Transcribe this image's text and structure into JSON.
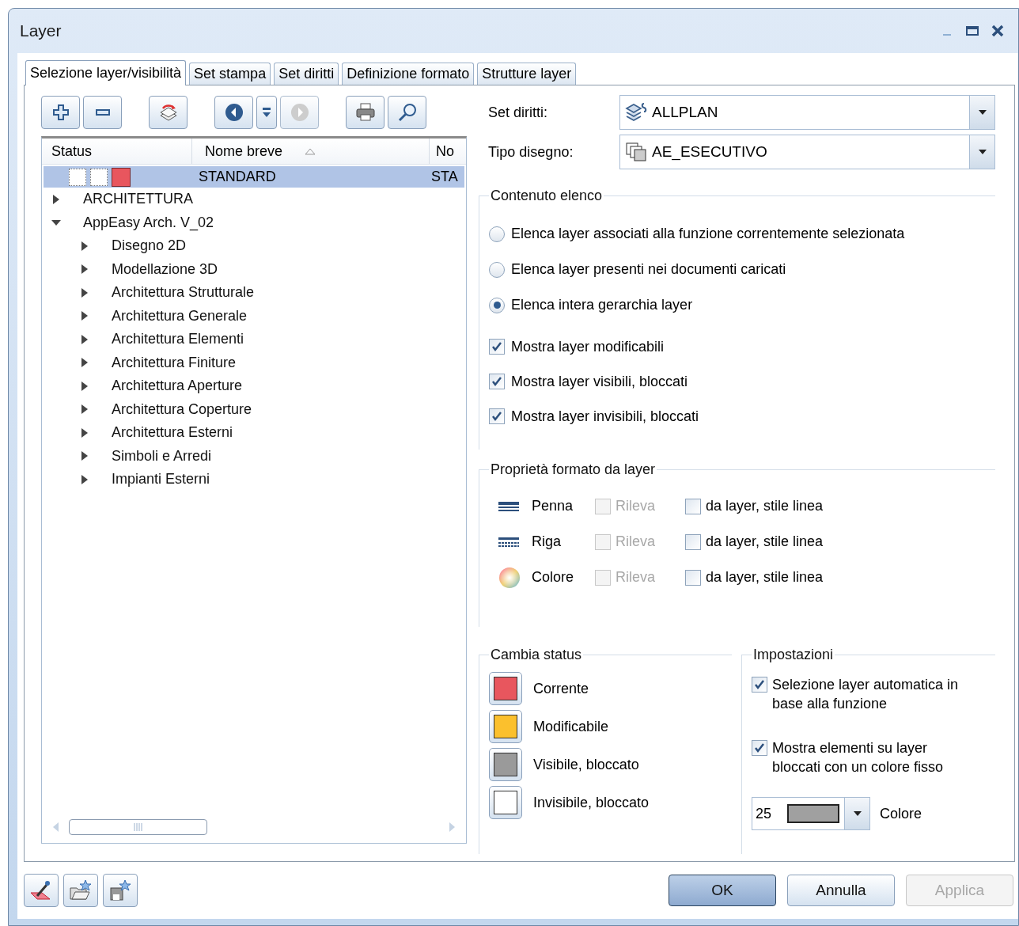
{
  "window": {
    "title": "Layer"
  },
  "tabs": [
    {
      "label": "Selezione layer/visibilità",
      "selected": true
    },
    {
      "label": "Set stampa",
      "selected": false
    },
    {
      "label": "Set diritti",
      "selected": false
    },
    {
      "label": "Definizione formato",
      "selected": false
    },
    {
      "label": "Strutture layer",
      "selected": false
    }
  ],
  "toolbar": [
    {
      "kind": "add",
      "disabled": false
    },
    {
      "kind": "remove",
      "disabled": false
    },
    {
      "kind": "refresh",
      "disabled": false
    },
    {
      "kind": "back",
      "disabled": false
    },
    {
      "kind": "menu",
      "disabled": false
    },
    {
      "kind": "forward",
      "disabled": true
    },
    {
      "kind": "print",
      "disabled": false
    },
    {
      "kind": "search",
      "disabled": false
    }
  ],
  "layer_list": {
    "columns": [
      {
        "label": "Status",
        "sorted": false
      },
      {
        "label": "Nome breve",
        "sorted": true
      },
      {
        "label": "No",
        "sorted": false
      }
    ],
    "current_row": {
      "short_name": "STANDARD",
      "column_3": "STA",
      "selected": true,
      "color": "#e8565e"
    },
    "tree": [
      {
        "label": "ARCHITETTURA",
        "expanded": false
      },
      {
        "label": "AppEasy Arch. V_02",
        "expanded": true,
        "children": [
          {
            "label": "Disegno 2D",
            "expanded": false
          },
          {
            "label": "Modellazione 3D",
            "expanded": false
          },
          {
            "label": "Architettura Strutturale",
            "expanded": false
          },
          {
            "label": "Architettura Generale",
            "expanded": false
          },
          {
            "label": "Architettura Elementi",
            "expanded": false
          },
          {
            "label": "Architettura Finiture",
            "expanded": false
          },
          {
            "label": "Architettura Aperture",
            "expanded": false
          },
          {
            "label": "Architettura Coperture",
            "expanded": false
          },
          {
            "label": "Architettura Esterni",
            "expanded": false
          },
          {
            "label": "Simboli e Arredi",
            "expanded": false
          },
          {
            "label": "Impianti Esterni",
            "expanded": false
          }
        ]
      }
    ]
  },
  "fields": [
    {
      "label": "Set diritti:",
      "value": "ALLPLAN",
      "kind": "rights"
    },
    {
      "label": "Tipo disegno:",
      "value": "AE_ESECUTIVO",
      "kind": "drawing"
    }
  ],
  "list_content": {
    "title": "Contenuto elenco",
    "radios": [
      {
        "label": "Elenca layer associati alla funzione correntemente selezionata",
        "selected": false
      },
      {
        "label": "Elenca layer presenti nei documenti caricati",
        "selected": false
      },
      {
        "label": "Elenca intera gerarchia layer",
        "selected": true
      }
    ],
    "checkboxes": [
      {
        "label": "Mostra layer modificabili",
        "checked": true
      },
      {
        "label": "Mostra layer visibili, bloccati",
        "checked": true
      },
      {
        "label": "Mostra layer invisibili, bloccati",
        "checked": true
      }
    ]
  },
  "format_properties": {
    "title": "Proprietà formato da layer",
    "rows": [
      {
        "kind": "pen",
        "label": "Penna",
        "pick_label": "Rileva",
        "pick_checked": false,
        "pick_disabled": true,
        "option_label": "da layer, stile linea",
        "option_checked": false
      },
      {
        "kind": "line",
        "label": "Riga",
        "pick_label": "Rileva",
        "pick_checked": false,
        "pick_disabled": true,
        "option_label": "da layer, stile linea",
        "option_checked": false
      },
      {
        "kind": "color",
        "label": "Colore",
        "pick_label": "Rileva",
        "pick_checked": false,
        "pick_disabled": true,
        "option_label": "da layer, stile linea",
        "option_checked": false
      }
    ]
  },
  "change_status": {
    "title": "Cambia status",
    "items": [
      {
        "label": "Corrente",
        "color": "#e8565e"
      },
      {
        "label": "Modificabile",
        "color": "#fbc02d"
      },
      {
        "label": "Visibile, bloccato",
        "color": "#9a9a9a"
      },
      {
        "label": "Invisibile, bloccato",
        "color": "#ffffff"
      }
    ]
  },
  "settings": {
    "title": "Impostazioni",
    "checkboxes": [
      {
        "label": "Selezione layer automatica in base alla funzione",
        "checked": true
      },
      {
        "label": "Mostra elementi su layer bloccati con un colore fisso",
        "checked": true
      }
    ],
    "color_field": {
      "value": "25",
      "color": "#a0a0a0",
      "label": "Colore"
    }
  },
  "buttons": [
    {
      "label": "OK",
      "default": true,
      "disabled": false
    },
    {
      "label": "Annulla",
      "default": false,
      "disabled": false
    },
    {
      "label": "Applica",
      "default": false,
      "disabled": true
    }
  ]
}
